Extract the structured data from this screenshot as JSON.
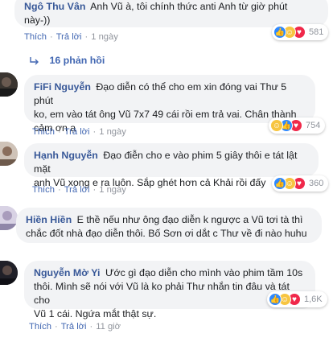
{
  "comments": [
    {
      "author": "Ngô Thu Vân",
      "text_lines": [
        "Anh Vũ à, tôi chính thức anti Anh từ giờ phút",
        "này-))"
      ],
      "like": "Thích",
      "reply": "Trả lời",
      "time": "1 ngày",
      "reaction_count": "581",
      "avatar_color": "#8a7a6a"
    },
    {
      "author": "FiFi Nguyễn",
      "text_lines": [
        "Đạo diễn có thể cho em xin đóng vai Thư 5 phút",
        "ko, em vào tát ông Vũ 7x7 49 cái rồi em trả vai. Chân thành",
        "cảm ơn ạ"
      ],
      "like": "Thích",
      "reply": "Trả lời",
      "time": "1 ngày",
      "reaction_count": "754",
      "avatar_color": "#2a2a2a"
    },
    {
      "author": "Hạnh Nguyễn",
      "text_lines": [
        "Đạo điễn cho e vào phim 5 giây thôi e tát lật mặt",
        "anh Vũ xong e ra luôn. Sắp ghét hơn cả Khải rồi đấy"
      ],
      "like": "Thích",
      "reply": "Trả lời",
      "time": "1 ngày",
      "reaction_count": "360",
      "avatar_color": "#b9a89a"
    },
    {
      "author": "Hiền Hiền",
      "text_lines": [
        "E thề nếu như ông đạo diễn k ngược a Vũ tơi tà thì",
        "chắc đốt nhà đạo diễn thôi. Bố Sơn ơi dắt c Thư về đi nào huhu"
      ],
      "like": "Thích",
      "reply": "Trả lời",
      "time": "1 ngày",
      "reaction_count": "",
      "avatar_color": "#c8c4d8"
    },
    {
      "author": "Nguyễn Mờ Yi",
      "text_lines": [
        "Ước gì đạo diễn cho mình vào phim tầm 10s",
        "thôi. Mình sẽ nói với Vũ là ko phải Thư nhắn tin đâu và tát cho",
        "Vũ 1 cái. Ngứa mắt thật sự."
      ],
      "like": "Thích",
      "reply": "Trả lời",
      "time": "11 giờ",
      "reaction_count": "1,6K",
      "avatar_color": "#1e1e28"
    }
  ],
  "replies_label": "16 phản hồi",
  "colors": {
    "link": "#4267b2",
    "author": "#385898",
    "bubble": "#f2f3f5",
    "meta": "#90949c"
  },
  "icons": {
    "reply_arrow": "reply-arrow-icon",
    "like": "like-reaction-icon",
    "haha": "haha-reaction-icon",
    "love": "love-reaction-icon"
  }
}
